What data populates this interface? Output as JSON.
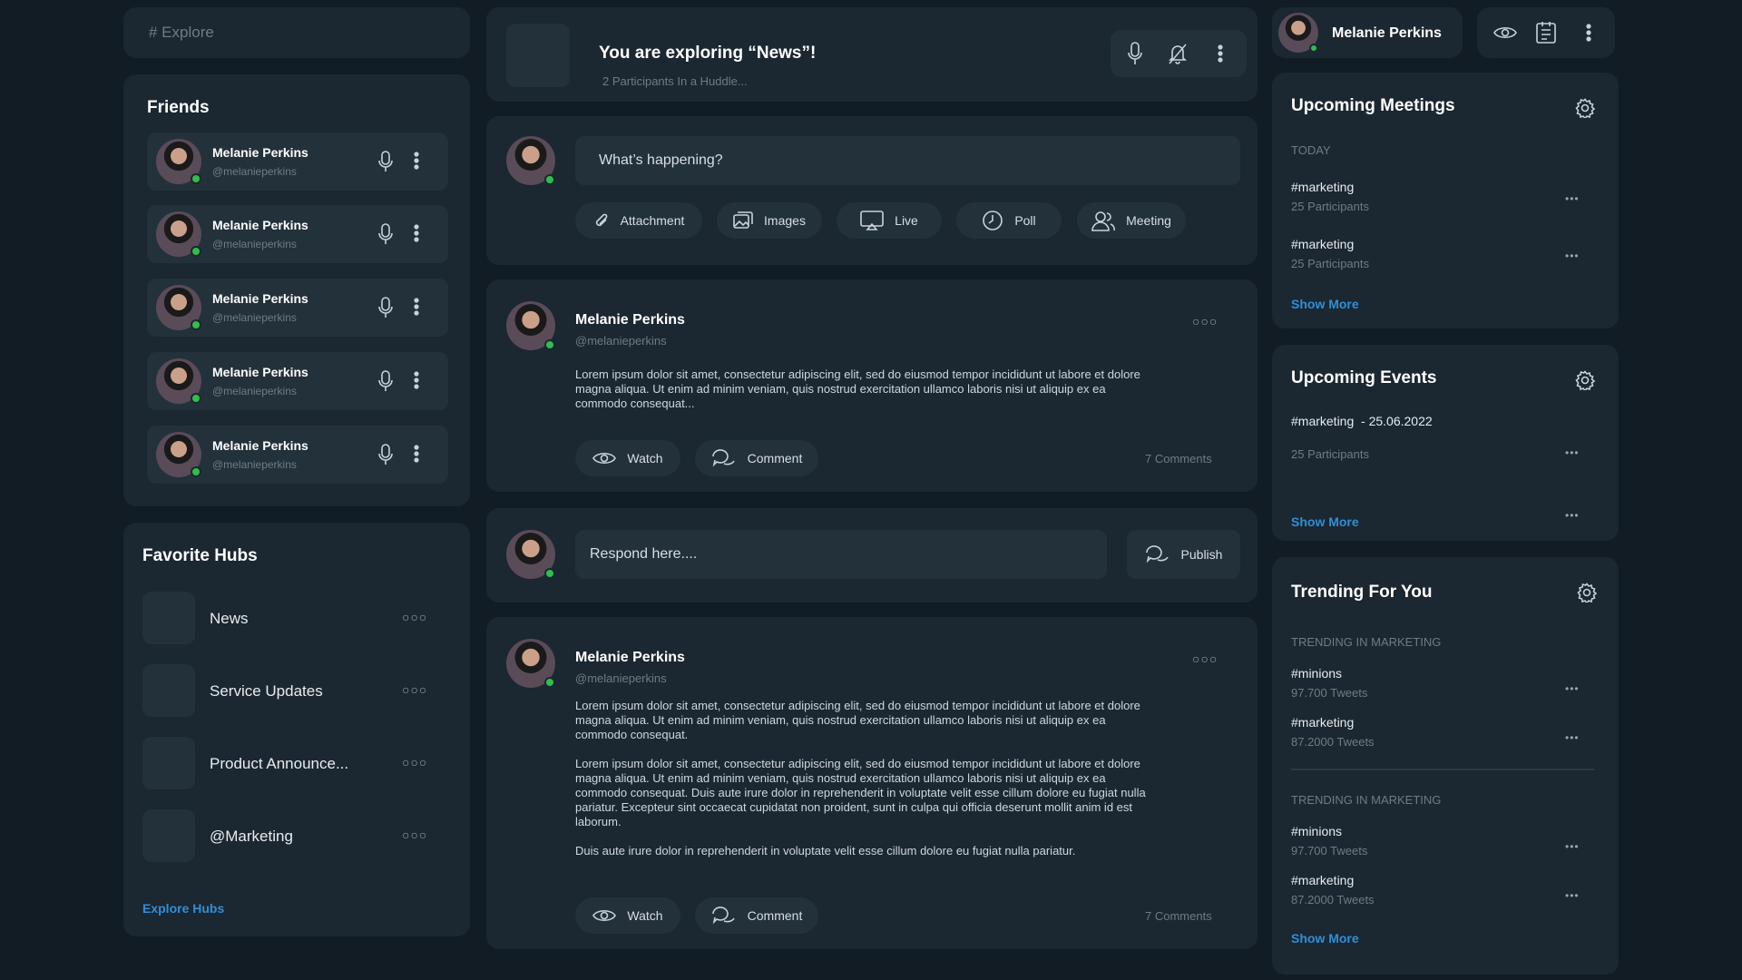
{
  "search": {
    "placeholder": "# Explore"
  },
  "friends": {
    "title": "Friends",
    "items": [
      {
        "name": "Melanie Perkins",
        "handle": "@melanieperkins"
      },
      {
        "name": "Melanie Perkins",
        "handle": "@melanieperkins"
      },
      {
        "name": "Melanie Perkins",
        "handle": "@melanieperkins"
      },
      {
        "name": "Melanie Perkins",
        "handle": "@melanieperkins"
      },
      {
        "name": "Melanie Perkins",
        "handle": "@melanieperkins"
      }
    ]
  },
  "hubs": {
    "title": "Favorite Hubs",
    "items": [
      {
        "label": "News"
      },
      {
        "label": "Service Updates"
      },
      {
        "label": "Product Announce..."
      },
      {
        "label": "@Marketing"
      }
    ],
    "explore_label": "Explore Hubs"
  },
  "huddle": {
    "title": "You are exploring “News”!",
    "subtitle": "2 Participants In a Huddle..."
  },
  "composer": {
    "placeholder": "What’s happening?",
    "actions": [
      {
        "label": "Attachment",
        "icon": "paperclip-icon"
      },
      {
        "label": "Images",
        "icon": "images-icon"
      },
      {
        "label": "Live",
        "icon": "live-icon"
      },
      {
        "label": "Poll",
        "icon": "clock-icon"
      },
      {
        "label": "Meeting",
        "icon": "users-icon"
      }
    ]
  },
  "post1": {
    "name": "Melanie Perkins",
    "handle": "@melanieperkins",
    "body": "Lorem ipsum dolor sit amet, consectetur adipiscing elit, sed do eiusmod tempor incididunt ut labore et dolore magna aliqua. Ut enim ad minim veniam, quis nostrud exercitation ullamco laboris nisi ut aliquip ex ea commodo consequat...",
    "watch": "Watch",
    "comment": "Comment",
    "comments_count": "7 Comments"
  },
  "respond": {
    "placeholder": "Respond here....",
    "publish": "Publish"
  },
  "post2": {
    "name": "Melanie Perkins",
    "handle": "@melanieperkins",
    "p1": "Lorem ipsum dolor sit amet, consectetur adipiscing elit, sed do eiusmod tempor incididunt ut labore et dolore magna aliqua. Ut enim ad minim veniam, quis nostrud exercitation ullamco laboris nisi ut aliquip ex ea commodo consequat.",
    "p2": "Lorem ipsum dolor sit amet, consectetur adipiscing elit, sed do eiusmod tempor incididunt ut labore et dolore magna aliqua. Ut enim ad minim veniam, quis nostrud exercitation ullamco laboris nisi ut aliquip ex ea commodo consequat. Duis aute irure dolor in reprehenderit in voluptate velit esse cillum dolore eu fugiat nulla pariatur. Excepteur sint occaecat cupidatat non proident, sunt in culpa qui officia deserunt mollit anim id est laborum.",
    "p3": "Duis aute irure dolor in reprehenderit in voluptate velit esse cillum dolore eu fugiat nulla pariatur.",
    "watch": "Watch",
    "comment": "Comment",
    "comments_count": "7 Comments"
  },
  "profile": {
    "name": "Melanie Perkins"
  },
  "meetings": {
    "title": "Upcoming Meetings",
    "day": "TODAY",
    "items": [
      {
        "tag": "#marketing",
        "sub": "25 Participants"
      },
      {
        "tag": "#marketing",
        "sub": "25 Participants"
      }
    ],
    "show_more": "Show More"
  },
  "events": {
    "title": "Upcoming Events",
    "tag": "#marketing",
    "date": "- 25.06.2022",
    "sub": "25 Participants",
    "show_more": "Show More"
  },
  "trending": {
    "title": "Trending For You",
    "groups": [
      {
        "heading": "TRENDING IN MARKETING",
        "items": [
          {
            "tag": "#minions",
            "sub": "97.700 Tweets"
          },
          {
            "tag": "#marketing",
            "sub": "87.2000 Tweets"
          }
        ]
      },
      {
        "heading": "TRENDING IN MARKETING",
        "items": [
          {
            "tag": "#minions",
            "sub": "97.700 Tweets"
          },
          {
            "tag": "#marketing",
            "sub": "87.2000 Tweets"
          }
        ]
      }
    ],
    "show_more": "Show More"
  },
  "colors": {
    "background": "#111c24",
    "card": "#1b2731",
    "inner": "#23313b",
    "accent": "#2f8fd8",
    "online": "#2fbf4a"
  }
}
